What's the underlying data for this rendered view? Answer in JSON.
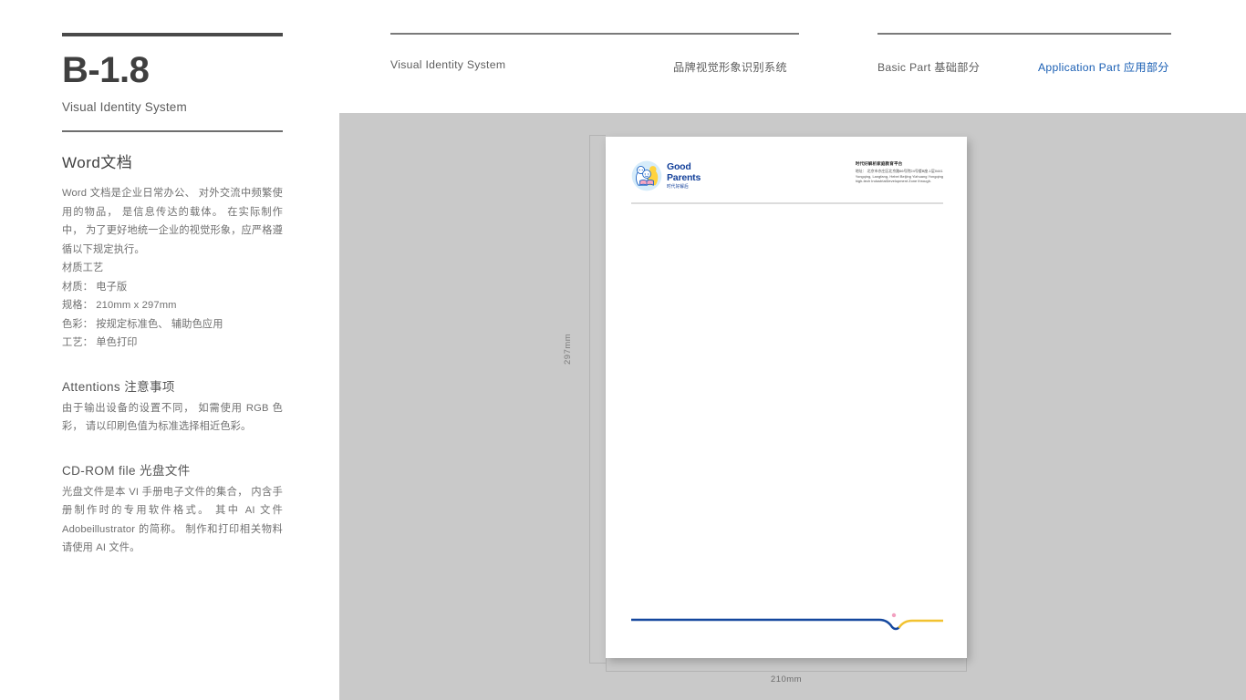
{
  "sidebar": {
    "code": "B-1.8",
    "code_subtitle": "Visual Identity System",
    "section_title": "Word文档",
    "intro": "Word 文档是企业日常办公、 对外交流中频繁使用的物品， 是信息传达的载体。 在实际制作中， 为了更好地统一企业的视觉形象，应严格遵循以下规定执行。",
    "spec_heading": "材质工艺",
    "specs": [
      "材质： 电子版",
      "规格： 210mm x 297mm",
      "色彩： 按规定标准色、 辅助色应用",
      "工艺： 单色打印"
    ],
    "attentions": {
      "heading": "Attentions 注意事项",
      "body": "由于输出设备的设置不同， 如需使用 RGB 色彩， 请以印刷色值为标准选择相近色彩。"
    },
    "cdrom": {
      "heading": "CD-ROM file 光盘文件",
      "body": "光盘文件是本 VI 手册电子文件的集合， 内含手册制作时的专用软件格式。 其中 AI 文件 Adobeillustrator 的简称。 制作和打印相关物料请使用 AI 文件。"
    }
  },
  "nav": {
    "items": [
      {
        "label": "Visual Identity System",
        "active": false
      },
      {
        "label": "品牌视觉形象识别系统",
        "active": false
      },
      {
        "label": "Basic Part 基础部分",
        "active": false
      },
      {
        "label": "Application Part 应用部分",
        "active": true
      }
    ],
    "active_color": "#1a5fb4"
  },
  "canvas": {
    "background": "#c9c9c9",
    "dimension_height": "297mm",
    "dimension_width": "210mm"
  },
  "letterhead": {
    "logo": {
      "icon": "good-parents-logo",
      "badge_color": "#cfe8f7",
      "accent_yellow": "#ffd24d",
      "accent_blue": "#1b62c4",
      "accent_pink": "#f06292",
      "wordmark_line1": "Good",
      "wordmark_line2": "Parents",
      "wordmark_cn": "时代好解后",
      "wordmark_color": "#13409a"
    },
    "address": {
      "title": "时代好解析家庭教育平台",
      "line_cn": "地址： 北京市亦庄区北京路66号院24号楼B座-1层0441",
      "line_en_1": "Yongqing, Langfang, Hebei Beijing Yizhuang Yongqing",
      "line_en_2": "high-tech IndustrialDevelopment Zone through."
    },
    "rule_color": "#dcdcdc"
  },
  "footer_art": {
    "blue": "#14479e",
    "yellow": "#f2c230",
    "dot": "#f2a0c0"
  }
}
